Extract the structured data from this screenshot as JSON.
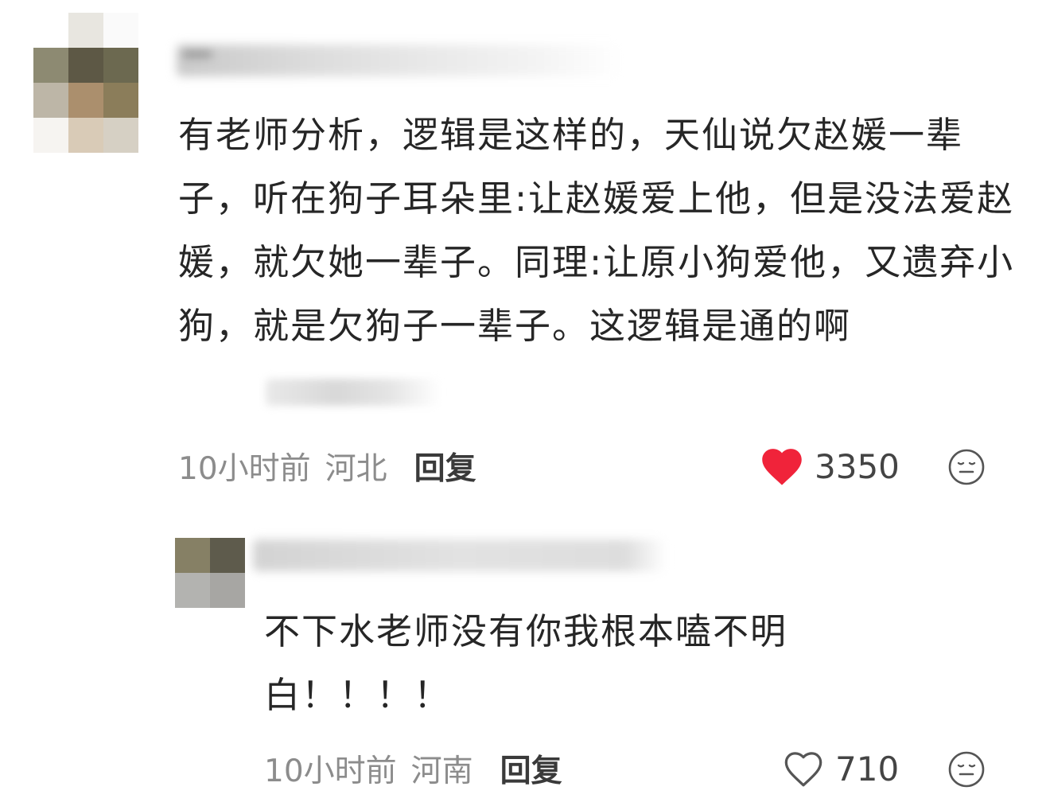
{
  "comments": [
    {
      "text": "有老师分析，逻辑是这样的，天仙说欠赵媛一辈子，听在狗子耳朵里:让赵媛爱上他，但是没法爱赵媛，就欠她一辈子。同理:让原小狗爱他，又遗弃小狗，就是欠狗子一辈子。这逻辑是通的啊",
      "time": "10小时前",
      "location": "河北",
      "reply_label": "回复",
      "likes": "3350",
      "liked": true
    },
    {
      "text": "不下水老师没有你我根本嗑不明白！！！！",
      "time": "10小时前",
      "location": "河南",
      "reply_label": "回复",
      "likes": "710",
      "liked": false
    }
  ],
  "icons": {
    "like_filled": "heart-filled-icon",
    "like_outline": "heart-outline-icon",
    "emoji": "neutral-face-icon"
  },
  "colors": {
    "like_active": "#f0233a",
    "meta_text": "#8c8c8c",
    "body_text": "#262626"
  }
}
